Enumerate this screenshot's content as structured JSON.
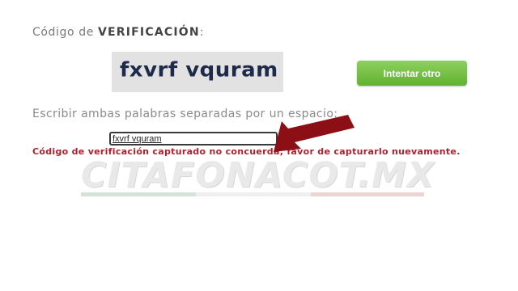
{
  "form": {
    "heading_prefix": "Código de ",
    "heading_strong": "VERIFICACIÓN",
    "heading_suffix": ":",
    "captcha_text": "fxvrf vquram",
    "retry_button_label": "Intentar otro",
    "instruction": "Escribir ambas palabras separadas por un espacio:",
    "input_value": "fxvrf vquram",
    "error_message": "Código de verificación capturado no concuerda, favor de capturarlo nuevamente."
  },
  "watermark": {
    "text": "CITAFONACOT.MX"
  },
  "colors": {
    "button_green": "#62b22f",
    "error_red": "#b21e2b",
    "arrow_red": "#8b0f14"
  },
  "icons": {
    "pointer": "arrow-icon"
  }
}
